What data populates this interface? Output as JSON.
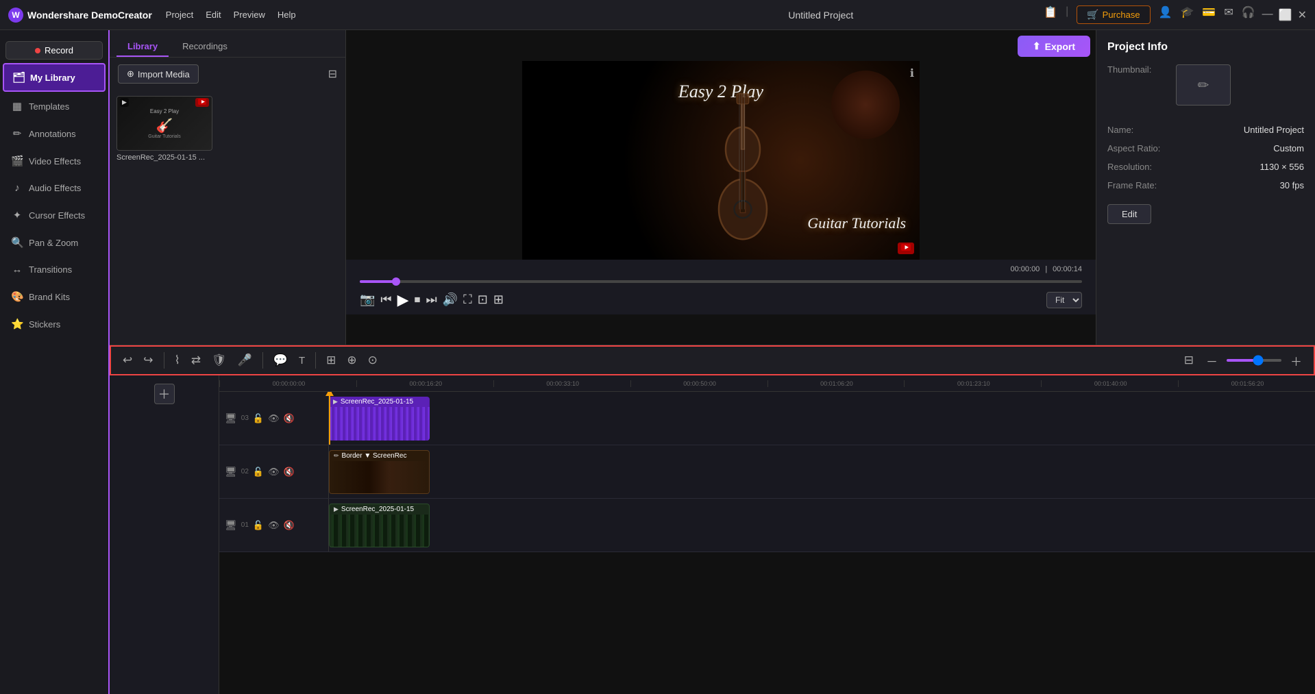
{
  "app": {
    "name": "Wondershare DemoCreator",
    "title": "Untitled Project"
  },
  "topbar": {
    "menu_items": [
      "Project",
      "Edit",
      "Preview",
      "Help"
    ],
    "purchase_label": "Purchase",
    "export_label": "Export",
    "record_label": "Record"
  },
  "sidebar": {
    "items": [
      {
        "id": "my-library",
        "label": "My Library",
        "icon": "🗂",
        "active": true
      },
      {
        "id": "templates",
        "label": "Templates",
        "icon": "▦"
      },
      {
        "id": "annotations",
        "label": "Annotations",
        "icon": "📝"
      },
      {
        "id": "video-effects",
        "label": "Video Effects",
        "icon": "🎬"
      },
      {
        "id": "audio-effects",
        "label": "Audio Effects",
        "icon": "🎵"
      },
      {
        "id": "cursor-effects",
        "label": "Cursor Effects",
        "icon": "🖱"
      },
      {
        "id": "pan-zoom",
        "label": "Pan & Zoom",
        "icon": "🔍"
      },
      {
        "id": "transitions",
        "label": "Transitions",
        "icon": "↔"
      },
      {
        "id": "brand-kits",
        "label": "Brand Kits",
        "icon": "🎨"
      },
      {
        "id": "stickers",
        "label": "Stickers",
        "icon": "⭐"
      }
    ]
  },
  "library": {
    "tabs": [
      "Library",
      "Recordings"
    ],
    "active_tab": "Library",
    "import_label": "Import Media",
    "media_items": [
      {
        "name": "ScreenRec_2025-01-15 ...",
        "type": "video"
      }
    ]
  },
  "preview": {
    "video_title_top": "Easy 2 Play",
    "video_title_bottom": "Guitar Tutorials",
    "time_current": "00:00:00",
    "time_total": "00:00:14",
    "fit_option": "Fit"
  },
  "project_info": {
    "title": "Project Info",
    "thumbnail_label": "Thumbnail:",
    "name_label": "Name:",
    "name_value": "Untitled Project",
    "aspect_ratio_label": "Aspect Ratio:",
    "aspect_ratio_value": "Custom",
    "resolution_label": "Resolution:",
    "resolution_value": "1130 × 556",
    "frame_rate_label": "Frame Rate:",
    "frame_rate_value": "30 fps",
    "edit_btn_label": "Edit"
  },
  "timeline": {
    "ruler_marks": [
      "00:00:00:00",
      "00:00:16:20",
      "00:00:33:10",
      "00:00:50:00",
      "00:01:06:20",
      "00:01:23:10",
      "00:01:40:00",
      "00:01:56:20"
    ],
    "tracks": [
      {
        "num": "03",
        "clip_label": "ScreenRec_2025-01-15",
        "clip_type": "video",
        "clip_color": "purple"
      },
      {
        "num": "02",
        "clip_label": "Border ▼  ScreenRec",
        "clip_type": "video",
        "clip_color": "dark"
      },
      {
        "num": "01",
        "clip_label": "ScreenRec_2025-01-15",
        "clip_type": "video",
        "clip_color": "green"
      }
    ]
  },
  "toolbar": {
    "tools": [
      "↩",
      "↪",
      "✂",
      "⇄",
      "🛡",
      "🎤",
      "💬",
      "T",
      "⊞",
      "⊕",
      "⊙"
    ]
  }
}
